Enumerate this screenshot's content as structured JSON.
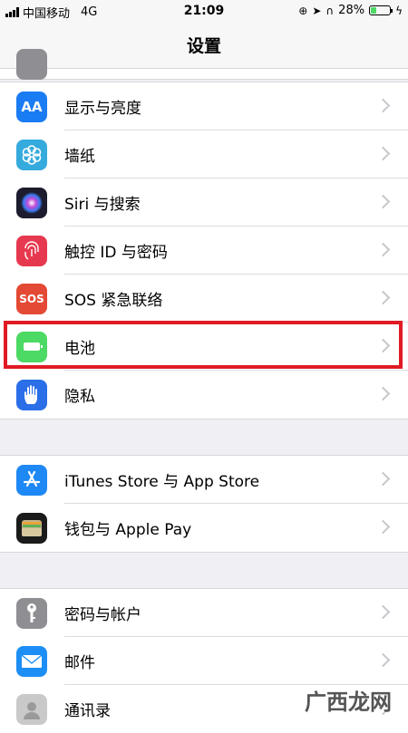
{
  "status_bar": {
    "carrier": "中国移动",
    "network": "4G",
    "time": "21:09",
    "battery_percent_text": "28%",
    "battery_level": 0.28
  },
  "navbar": {
    "title": "设置"
  },
  "sections": [
    {
      "items": [
        {
          "label": "显示与亮度",
          "icon": "display-brightness-icon",
          "color": "#1a7cf3"
        },
        {
          "label": "墙纸",
          "icon": "wallpaper-flower-icon",
          "color": "#35aadc"
        },
        {
          "label": "Siri 与搜索",
          "icon": "siri-icon",
          "color": "#1c1c2e"
        },
        {
          "label": "触控 ID 与密码",
          "icon": "fingerprint-icon",
          "color": "#e6394f"
        },
        {
          "label": "SOS 紧急联络",
          "icon": "sos-icon",
          "color": "#e34934"
        },
        {
          "label": "电池",
          "icon": "battery-icon",
          "color": "#4cd964"
        },
        {
          "label": "隐私",
          "icon": "privacy-hand-icon",
          "color": "#2a6ee8"
        }
      ]
    },
    {
      "items": [
        {
          "label": "iTunes Store 与 App Store",
          "icon": "app-store-icon",
          "color": "#1e88f5"
        },
        {
          "label": "钱包与 Apple Pay",
          "icon": "wallet-icon",
          "color": "#1b1b1b"
        }
      ]
    },
    {
      "items": [
        {
          "label": "密码与帐户",
          "icon": "key-icon",
          "color": "#8e8e93"
        },
        {
          "label": "邮件",
          "icon": "mail-icon",
          "color": "#1d8ef5"
        },
        {
          "label": "通讯录",
          "icon": "contacts-icon",
          "color": "#c9c9c9"
        }
      ]
    }
  ],
  "icon_text": {
    "aa": "AA",
    "sos": "SOS"
  },
  "watermark": "广西龙网"
}
